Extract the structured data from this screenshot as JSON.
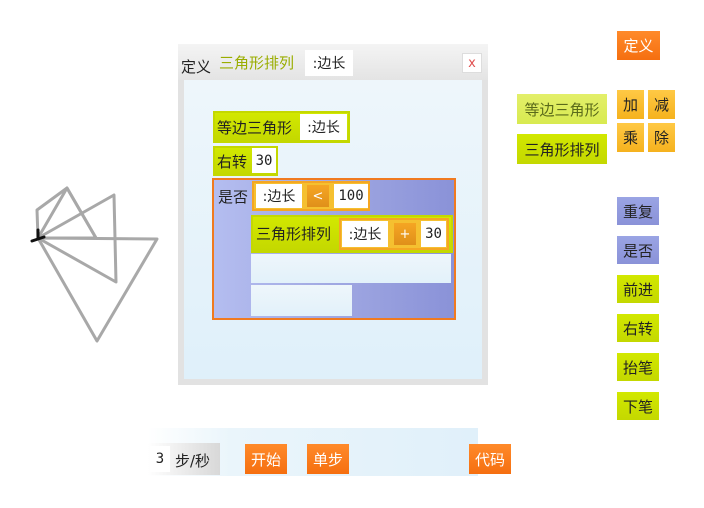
{
  "palette": {
    "define": "定义",
    "custom_blocks": [
      "等边三角形",
      "三角形排列"
    ],
    "math_ops": [
      "加",
      "减",
      "乘",
      "除"
    ],
    "commands": [
      "重复",
      "是否",
      "前进",
      "右转",
      "抬笔",
      "下笔"
    ]
  },
  "editor": {
    "define_label": "定义",
    "proc_name": "三角形排列",
    "param": ":边长",
    "close_icon": "x",
    "body": {
      "call1_name": "等边三角形",
      "call1_arg": ":边长",
      "turn_label": "右转",
      "turn_value": "30",
      "if_label": "是否",
      "cond_var": ":边长",
      "cond_op": "<",
      "cond_value": "100",
      "recurse_name": "三角形排列",
      "recurse_var": ":边长",
      "recurse_op": "+",
      "recurse_value": "30"
    }
  },
  "controls": {
    "speed_value": "3",
    "speed_unit": "步/秒",
    "start_label": "开始",
    "step_label": "单步",
    "code_label": "代码"
  },
  "colors": {
    "orange": "#f57a1a",
    "yellow_green": "#cce000",
    "gold": "#f8b828",
    "purple": "#8f98dc",
    "title_green": "#9aad00",
    "close_red": "#e05050"
  }
}
